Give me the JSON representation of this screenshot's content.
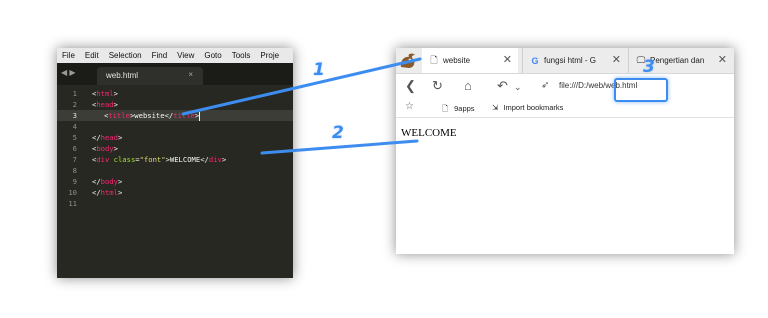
{
  "editor": {
    "menu": [
      "File",
      "Edit",
      "Selection",
      "Find",
      "View",
      "Goto",
      "Tools",
      "Proje"
    ],
    "nav_arrows": "◀ ▶",
    "tab": {
      "name": "web.html",
      "close": "×"
    },
    "lines": [
      {
        "n": "1"
      },
      {
        "n": "2"
      },
      {
        "n": "3"
      },
      {
        "n": "4"
      },
      {
        "n": "5"
      },
      {
        "n": "6"
      },
      {
        "n": "7"
      },
      {
        "n": "8"
      },
      {
        "n": "9"
      },
      {
        "n": "10"
      },
      {
        "n": "11"
      }
    ],
    "code": {
      "html_open": "html",
      "head_open": "head",
      "title_tag": "title",
      "title_text": "website",
      "title_close": "title",
      "head_close": "head",
      "body_open": "body",
      "div_tag": "div",
      "div_attr": "class",
      "div_attr_val": "\"font\"",
      "div_text": "WELCOME",
      "div_close": "div",
      "body_close": "body",
      "html_close": "html",
      "lt": "<",
      "gt": ">",
      "lts": "</",
      "eq": "="
    },
    "colors": {
      "background": "#272822",
      "tag": "#f92672",
      "attribute": "#a6e22e",
      "string": "#e6db74"
    }
  },
  "browser": {
    "tabs": [
      {
        "label": "website",
        "icon": "page-icon"
      },
      {
        "label": "fungsi html - G",
        "icon": "google-icon"
      },
      {
        "label": "Pengertian dan",
        "icon": "monitor-icon"
      }
    ],
    "tab_close": "✕",
    "url": "file:///D:/web/web.html",
    "bookmarks": [
      {
        "label": "9apps",
        "icon": "page-icon"
      },
      {
        "label": "Import bookmarks",
        "icon": "import-icon"
      }
    ],
    "page_content": "WELCOME"
  },
  "annotations": {
    "labels": [
      "1",
      "2",
      "3"
    ],
    "color": "#3d8df0"
  }
}
